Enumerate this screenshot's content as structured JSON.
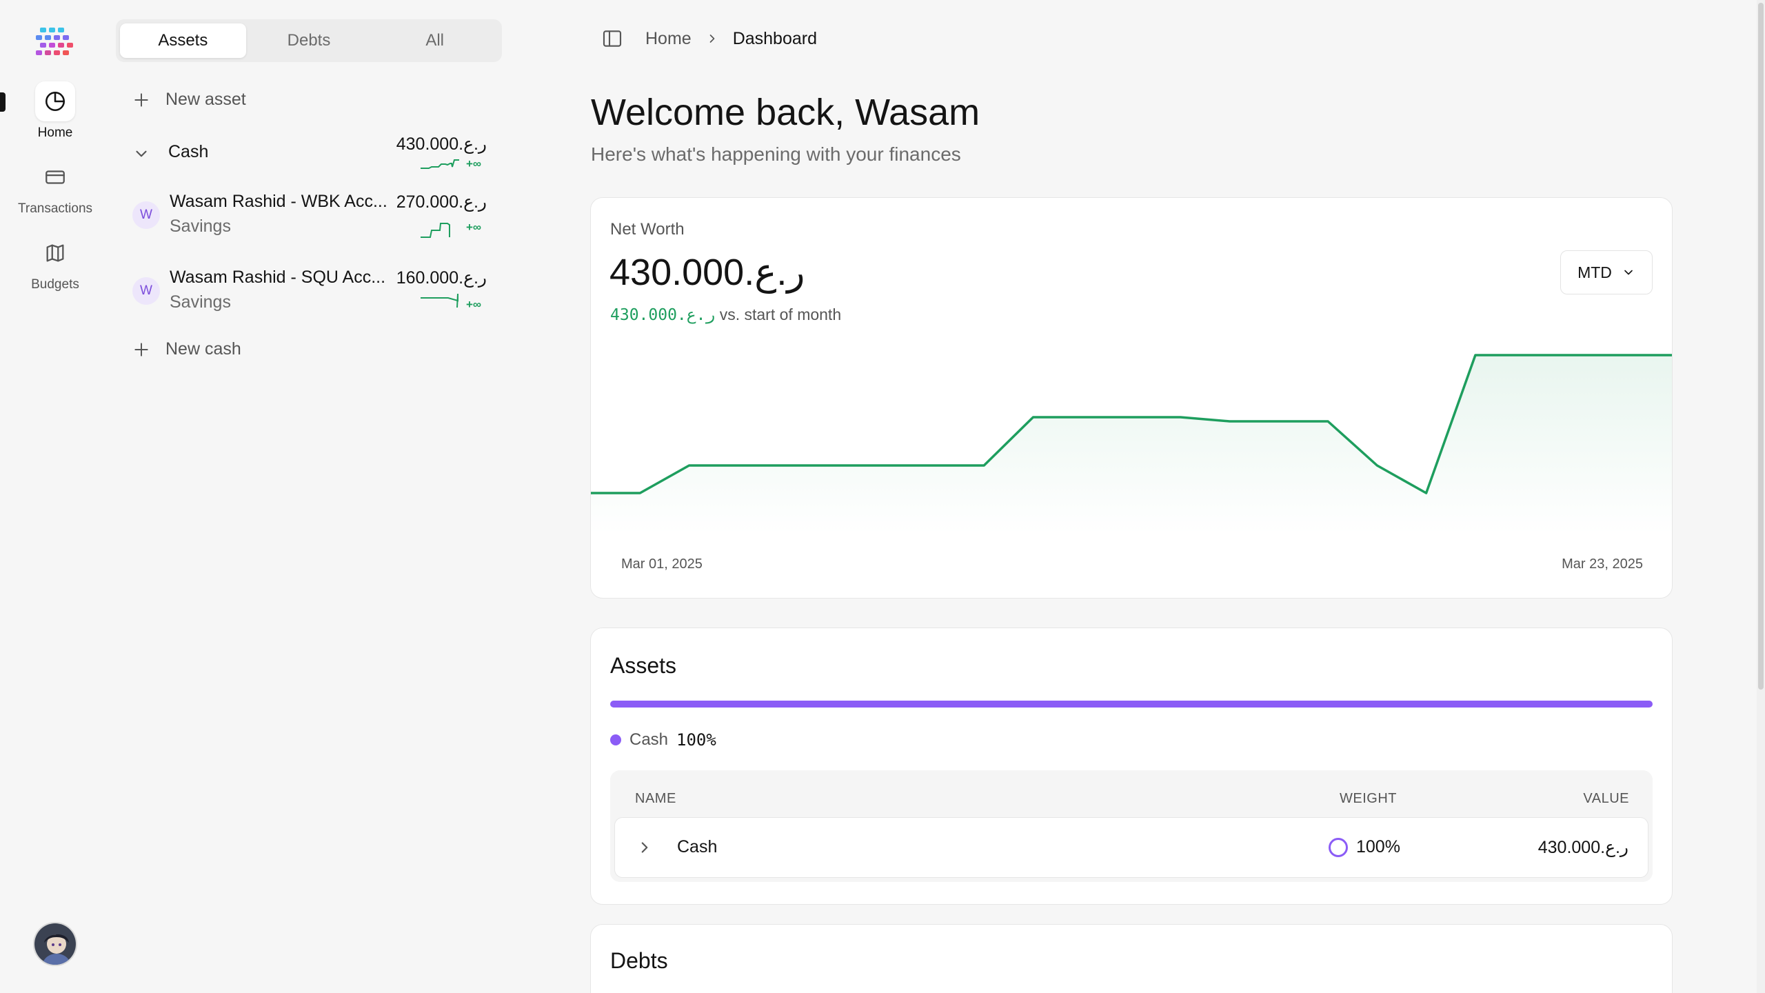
{
  "nav": {
    "items": [
      {
        "label": "Home",
        "icon": "pie-chart-icon",
        "active": true
      },
      {
        "label": "Transactions",
        "icon": "credit-card-icon",
        "active": false
      },
      {
        "label": "Budgets",
        "icon": "map-icon",
        "active": false
      }
    ]
  },
  "panel": {
    "tabs": [
      "Assets",
      "Debts",
      "All"
    ],
    "active_tab": "Assets",
    "new_asset_label": "New asset",
    "new_cash_label": "New cash",
    "group": {
      "name": "Cash",
      "amount": "430.000.ر.ع",
      "trend": "+∞"
    },
    "accounts": [
      {
        "initial": "W",
        "name": "Wasam Rashid - WBK Acc...",
        "type": "Savings",
        "amount": "270.000.ر.ع",
        "trend": "+∞"
      },
      {
        "initial": "W",
        "name": "Wasam Rashid - SQU Acc...",
        "type": "Savings",
        "amount": "160.000.ر.ع",
        "trend": "+∞"
      }
    ]
  },
  "breadcrumb": {
    "home": "Home",
    "current": "Dashboard"
  },
  "welcome": {
    "title": "Welcome back, Wasam",
    "subtitle": "Here's what's happening with your finances"
  },
  "net_worth": {
    "label": "Net Worth",
    "value": "430.000.ر.ع",
    "change_value": "430.000.ر.ع",
    "change_text": "vs. start of month",
    "period": "MTD",
    "x_start": "Mar 01, 2025",
    "x_end": "Mar 23, 2025",
    "line_color": "#1e9e5e"
  },
  "chart_data": {
    "type": "line",
    "title": "Net Worth",
    "x": [
      "Mar 01, 2025",
      "",
      "",
      "",
      "",
      "",
      "",
      "",
      "",
      "",
      "",
      "",
      "",
      "",
      "",
      "",
      "",
      "",
      "",
      "",
      "",
      "",
      "Mar 23, 2025"
    ],
    "series": [
      {
        "values": [
          0,
          0,
          0.2,
          0.2,
          0.2,
          0.2,
          0.2,
          0.2,
          0.2,
          0.55,
          0.55,
          0.55,
          0.55,
          0.52,
          0.52,
          0.52,
          0.2,
          0,
          1.0,
          1.0,
          1.0,
          1.0,
          1.0
        ]
      }
    ],
    "grid": false
  },
  "assets": {
    "title": "Assets",
    "bar_color": "#8b5cf6",
    "legend": {
      "name": "Cash",
      "percent": "100%"
    },
    "table": {
      "headers": {
        "name": "NAME",
        "weight": "WEIGHT",
        "value": "VALUE"
      },
      "rows": [
        {
          "name": "Cash",
          "weight": "100%",
          "value": "430.000.ر.ع"
        }
      ]
    }
  },
  "debts": {
    "title": "Debts"
  }
}
